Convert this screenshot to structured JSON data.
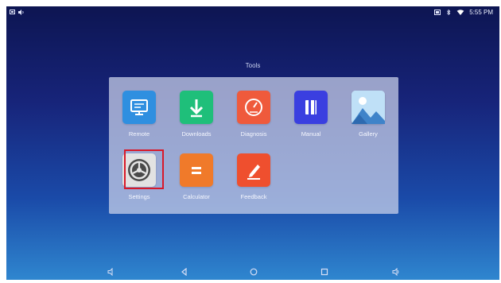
{
  "status_bar": {
    "left_icons": [
      "notification-icon",
      "speaker-icon"
    ],
    "right_icons": [
      "cast-icon",
      "bluetooth-icon",
      "wifi-icon"
    ],
    "time": "5:55 PM"
  },
  "folder": {
    "title": "Tools",
    "apps": [
      {
        "label": "Remote",
        "icon": "monitor-icon",
        "color": "#2f8fe0"
      },
      {
        "label": "Downloads",
        "icon": "download-arrow-icon",
        "color": "#1fbf7a"
      },
      {
        "label": "Diagnosis",
        "icon": "speedometer-icon",
        "color": "#ef5a3c"
      },
      {
        "label": "Manual",
        "icon": "book-icon",
        "color": "#3a3fe0"
      },
      {
        "label": "Gallery",
        "icon": "mountains-icon",
        "color": "#5fb3ee"
      },
      {
        "label": "Settings",
        "icon": "gear-icon",
        "color": "#d8d8d8"
      },
      {
        "label": "Calculator",
        "icon": "equals-icon",
        "color": "#f07a2a"
      },
      {
        "label": "Feedback",
        "icon": "pen-icon",
        "color": "#ef4f2e"
      }
    ],
    "selected": "Settings",
    "selection_color": "#d8192a"
  },
  "nav_bar": {
    "buttons": [
      "volume-down-icon",
      "back-icon",
      "home-icon",
      "recents-icon",
      "volume-up-icon"
    ]
  }
}
